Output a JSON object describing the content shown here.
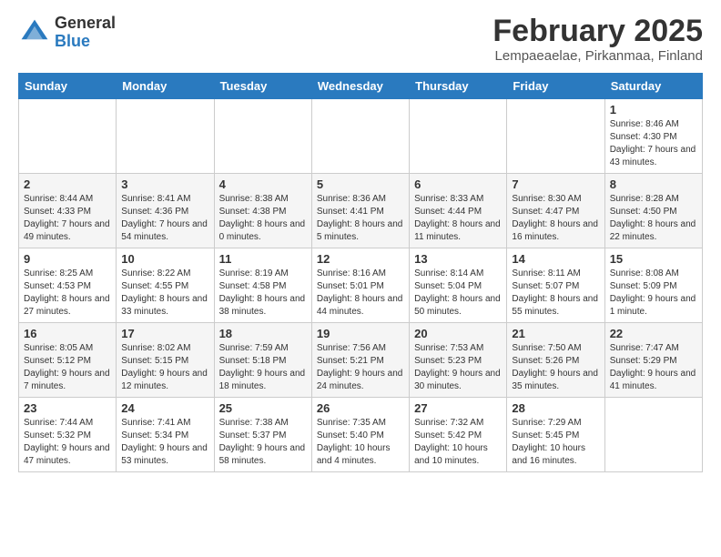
{
  "logo": {
    "general": "General",
    "blue": "Blue"
  },
  "header": {
    "month": "February 2025",
    "location": "Lempaeaelae, Pirkanmaa, Finland"
  },
  "weekdays": [
    "Sunday",
    "Monday",
    "Tuesday",
    "Wednesday",
    "Thursday",
    "Friday",
    "Saturday"
  ],
  "weeks": [
    [
      {
        "day": "",
        "info": ""
      },
      {
        "day": "",
        "info": ""
      },
      {
        "day": "",
        "info": ""
      },
      {
        "day": "",
        "info": ""
      },
      {
        "day": "",
        "info": ""
      },
      {
        "day": "",
        "info": ""
      },
      {
        "day": "1",
        "info": "Sunrise: 8:46 AM\nSunset: 4:30 PM\nDaylight: 7 hours and 43 minutes."
      }
    ],
    [
      {
        "day": "2",
        "info": "Sunrise: 8:44 AM\nSunset: 4:33 PM\nDaylight: 7 hours and 49 minutes."
      },
      {
        "day": "3",
        "info": "Sunrise: 8:41 AM\nSunset: 4:36 PM\nDaylight: 7 hours and 54 minutes."
      },
      {
        "day": "4",
        "info": "Sunrise: 8:38 AM\nSunset: 4:38 PM\nDaylight: 8 hours and 0 minutes."
      },
      {
        "day": "5",
        "info": "Sunrise: 8:36 AM\nSunset: 4:41 PM\nDaylight: 8 hours and 5 minutes."
      },
      {
        "day": "6",
        "info": "Sunrise: 8:33 AM\nSunset: 4:44 PM\nDaylight: 8 hours and 11 minutes."
      },
      {
        "day": "7",
        "info": "Sunrise: 8:30 AM\nSunset: 4:47 PM\nDaylight: 8 hours and 16 minutes."
      },
      {
        "day": "8",
        "info": "Sunrise: 8:28 AM\nSunset: 4:50 PM\nDaylight: 8 hours and 22 minutes."
      }
    ],
    [
      {
        "day": "9",
        "info": "Sunrise: 8:25 AM\nSunset: 4:53 PM\nDaylight: 8 hours and 27 minutes."
      },
      {
        "day": "10",
        "info": "Sunrise: 8:22 AM\nSunset: 4:55 PM\nDaylight: 8 hours and 33 minutes."
      },
      {
        "day": "11",
        "info": "Sunrise: 8:19 AM\nSunset: 4:58 PM\nDaylight: 8 hours and 38 minutes."
      },
      {
        "day": "12",
        "info": "Sunrise: 8:16 AM\nSunset: 5:01 PM\nDaylight: 8 hours and 44 minutes."
      },
      {
        "day": "13",
        "info": "Sunrise: 8:14 AM\nSunset: 5:04 PM\nDaylight: 8 hours and 50 minutes."
      },
      {
        "day": "14",
        "info": "Sunrise: 8:11 AM\nSunset: 5:07 PM\nDaylight: 8 hours and 55 minutes."
      },
      {
        "day": "15",
        "info": "Sunrise: 8:08 AM\nSunset: 5:09 PM\nDaylight: 9 hours and 1 minute."
      }
    ],
    [
      {
        "day": "16",
        "info": "Sunrise: 8:05 AM\nSunset: 5:12 PM\nDaylight: 9 hours and 7 minutes."
      },
      {
        "day": "17",
        "info": "Sunrise: 8:02 AM\nSunset: 5:15 PM\nDaylight: 9 hours and 12 minutes."
      },
      {
        "day": "18",
        "info": "Sunrise: 7:59 AM\nSunset: 5:18 PM\nDaylight: 9 hours and 18 minutes."
      },
      {
        "day": "19",
        "info": "Sunrise: 7:56 AM\nSunset: 5:21 PM\nDaylight: 9 hours and 24 minutes."
      },
      {
        "day": "20",
        "info": "Sunrise: 7:53 AM\nSunset: 5:23 PM\nDaylight: 9 hours and 30 minutes."
      },
      {
        "day": "21",
        "info": "Sunrise: 7:50 AM\nSunset: 5:26 PM\nDaylight: 9 hours and 35 minutes."
      },
      {
        "day": "22",
        "info": "Sunrise: 7:47 AM\nSunset: 5:29 PM\nDaylight: 9 hours and 41 minutes."
      }
    ],
    [
      {
        "day": "23",
        "info": "Sunrise: 7:44 AM\nSunset: 5:32 PM\nDaylight: 9 hours and 47 minutes."
      },
      {
        "day": "24",
        "info": "Sunrise: 7:41 AM\nSunset: 5:34 PM\nDaylight: 9 hours and 53 minutes."
      },
      {
        "day": "25",
        "info": "Sunrise: 7:38 AM\nSunset: 5:37 PM\nDaylight: 9 hours and 58 minutes."
      },
      {
        "day": "26",
        "info": "Sunrise: 7:35 AM\nSunset: 5:40 PM\nDaylight: 10 hours and 4 minutes."
      },
      {
        "day": "27",
        "info": "Sunrise: 7:32 AM\nSunset: 5:42 PM\nDaylight: 10 hours and 10 minutes."
      },
      {
        "day": "28",
        "info": "Sunrise: 7:29 AM\nSunset: 5:45 PM\nDaylight: 10 hours and 16 minutes."
      },
      {
        "day": "",
        "info": ""
      }
    ]
  ]
}
